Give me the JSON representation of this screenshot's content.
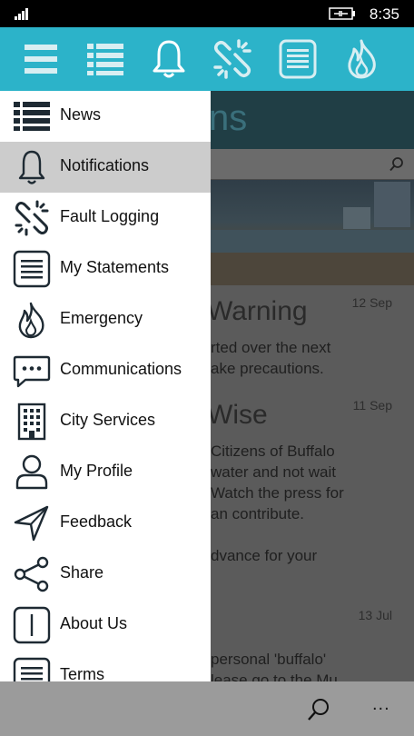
{
  "status_bar": {
    "time": "8:35"
  },
  "top_icons": [
    "menu-icon",
    "list-icon",
    "bell-icon",
    "broken-link-icon",
    "statement-icon",
    "fire-icon"
  ],
  "menu": {
    "items": [
      {
        "label": "News",
        "icon": "news-list-icon"
      },
      {
        "label": "Notifications",
        "icon": "bell-icon",
        "selected": true
      },
      {
        "label": "Fault Logging",
        "icon": "broken-link-icon"
      },
      {
        "label": "My Statements",
        "icon": "statement-icon"
      },
      {
        "label": "Emergency",
        "icon": "fire-icon"
      },
      {
        "label": "Communications",
        "icon": "chat-bubble-icon"
      },
      {
        "label": "City Services",
        "icon": "building-icon"
      },
      {
        "label": "My Profile",
        "icon": "person-icon"
      },
      {
        "label": "Feedback",
        "icon": "send-arrow-icon"
      },
      {
        "label": "Share",
        "icon": "share-icon"
      },
      {
        "label": "About Us",
        "icon": "info-icon"
      },
      {
        "label": "Terms",
        "icon": "terms-icon"
      }
    ]
  },
  "background_page": {
    "header_fragment": "ns",
    "news": [
      {
        "title_fragment": "Warning",
        "date": "12 Sep",
        "body": "rted over the next\nake precautions."
      },
      {
        "title_fragment": "Wise",
        "date": "11 Sep",
        "body": "Citizens of Buffalo\nwater and not wait\nWatch the press for\nan contribute.\n\ndvance for your"
      },
      {
        "title_fragment": "",
        "date": "13 Jul",
        "body": "personal 'buffalo'\nlease go to the Mu"
      }
    ]
  },
  "app_bar": {
    "more_label": "..."
  }
}
